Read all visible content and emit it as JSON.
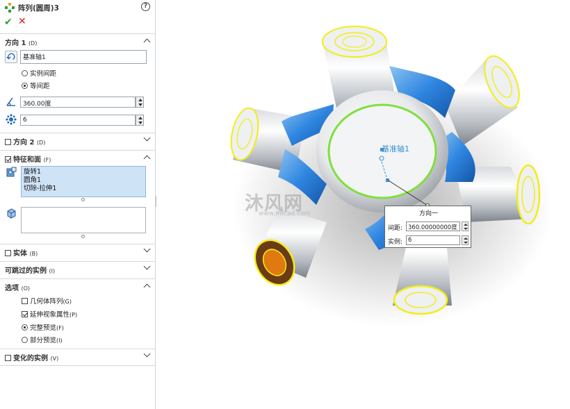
{
  "header": {
    "title": "阵列(圆周)3",
    "help": "?",
    "ok": "✔",
    "cancel": "✕"
  },
  "direction1": {
    "heading": "方向 1",
    "heading_key": "(D)",
    "axis_value": "基准轴1",
    "radio_spacing": "实例间距",
    "radio_equal": "等间距",
    "radio_selected": "equal",
    "angle_value": "360.00度",
    "count_value": "6"
  },
  "direction2": {
    "label": "方向 2",
    "key": "(D)",
    "checked": false
  },
  "features": {
    "label": "特征和面",
    "key": "(F)",
    "checked": true,
    "items": [
      "旋转1",
      "圆角1",
      "切除-拉伸1"
    ]
  },
  "bodies": {
    "label": "实体",
    "key": "(B)",
    "checked": false
  },
  "skipped": {
    "label": "可跳过的实例",
    "key": "(I)"
  },
  "options": {
    "label": "选项",
    "key": "(O)",
    "geometry_pattern": "几何体阵列",
    "geometry_key": "(G)",
    "geometry_checked": false,
    "propagate": "延伸视象属性",
    "propagate_key": "(P)",
    "propagate_checked": true,
    "full_preview": "完整预览",
    "full_key": "(F)",
    "partial_preview": "部分预览",
    "partial_key": "(I)",
    "preview_selected": "full"
  },
  "varying": {
    "label": "变化的实例",
    "key": "(V)",
    "checked": false
  },
  "viewport": {
    "axis_label": "基准轴1",
    "callout": {
      "title": "方向一",
      "spacing_label": "间距:",
      "spacing_value": "360.00000000度",
      "count_label": "实例:",
      "count_value": "6"
    },
    "watermark": "沐风网",
    "watermark_sub": "www.mfcad.com"
  },
  "colors": {
    "accent_blue": "#2f86e0",
    "highlight_green": "#7ee03a",
    "selection_yellow": "#f2ee16",
    "ok_green": "#2e9a2e",
    "cancel_red": "#d82121"
  }
}
